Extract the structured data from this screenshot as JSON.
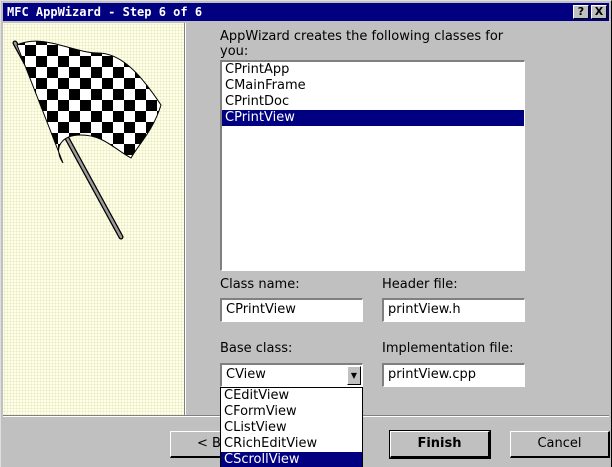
{
  "window": {
    "title": "MFC AppWizard - Step 6 of 6",
    "help_button": "?",
    "close_button": "X"
  },
  "main": {
    "classes_label": "AppWizard creates the following classes for you:",
    "classes": [
      "CPrintApp",
      "CMainFrame",
      "CPrintDoc",
      "CPrintView"
    ],
    "selected_class_index": 3,
    "class_name_label": "Class name:",
    "class_name_value": "CPrintView",
    "header_file_label": "Header file:",
    "header_file_value": "printView.h",
    "base_class_label": "Base class:",
    "base_class_value": "CView",
    "implementation_file_label": "Implementation file:",
    "implementation_file_value": "printView.cpp",
    "base_class_options": [
      "CEditView",
      "CFormView",
      "CListView",
      "CRichEditView",
      "CScrollView"
    ],
    "highlighted_option_index": 4
  },
  "buttons": {
    "back": "< B",
    "finish": "Finish",
    "cancel": "Cancel"
  },
  "art": {
    "icon": "checkered-flag-icon"
  }
}
